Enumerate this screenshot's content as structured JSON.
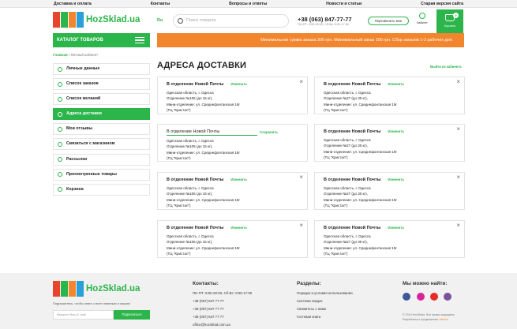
{
  "topbar": {
    "links": [
      "Доставка и оплата",
      "Контакты",
      "Вопросы и ответы",
      "Новости и статьи",
      "Старая версия сайта"
    ]
  },
  "header": {
    "logo_text": "HozSklad.ua",
    "lang": "Ru",
    "search_placeholder": "Поиск товаров",
    "phone": "+38 (063) 847-77-77",
    "hours": "ПН-ПТ: 9:00-20:00, Сб-Вс: 9:00-17:00",
    "callback": "Перезвонить мне",
    "cabinet": "Кабинет",
    "cart": "Корзина",
    "cart_count": "0"
  },
  "catalog_label": "КАТАЛОГ ТОВАРОВ",
  "promo": "Минимальная сумма заказа 300 грн. Минимальный заказ 100 грн. Сбор заказов 1-2 рабочих дня.",
  "breadcrumb": {
    "home": "Главная",
    "sep": " / ",
    "current": "Личный кабинет"
  },
  "menu": [
    {
      "label": "Личные данные",
      "active": false
    },
    {
      "label": "Список заказов",
      "active": false
    },
    {
      "label": "Список желаний",
      "active": false
    },
    {
      "label": "Адреса доставки",
      "active": true
    },
    {
      "label": "Мои отзывы",
      "active": false
    },
    {
      "label": "Связаться с магазином",
      "active": false
    },
    {
      "label": "Рассылки",
      "active": false
    },
    {
      "label": "Просмотренные товары",
      "active": false
    },
    {
      "label": "Корзина",
      "active": false
    }
  ],
  "page_title": "АДРЕСА ДОСТАВКИ",
  "logout": "Выйти из кабинета",
  "edit_label": "Изменить",
  "save_label": "Сохранить",
  "close_glyph": "×",
  "addresses": [
    {
      "title": "В отделение Новой Почты",
      "region": "Одесская область, г. Одесса",
      "branch": "Отделение №105 (до 15 кг),",
      "mini": "Мини-отделение: ул. Среднефонтанская 19г",
      "note": "(ТЦ \"Кристал\")",
      "editing": false
    },
    {
      "title": "В отделение Новой Почты",
      "region": "Одесская область, г. Одесса",
      "branch": "Отделение №27 (до 30 кг),",
      "mini": "Мини-отделение: ул. Среднефонтанская 19г",
      "note": "(ТЦ \"Кристал\")",
      "editing": false
    },
    {
      "title": "В отделение Новой Почты",
      "region": "Одесская область, г. Одесса",
      "branch": "Отделение №105 (до 15 кг),",
      "mini": "Мини-отделение: ул. Среднефонтанская 19г",
      "note": "(ТЦ \"Кристал\")",
      "editing": true
    },
    {
      "title": "В отделение Новой Почты",
      "region": "Одесская область, г. Одесса",
      "branch": "Отделение №27 (до 30 кг),",
      "mini": "Мини-отделение: ул. Среднефонтанская 19г",
      "note": "(ТЦ \"Кристал\")",
      "editing": false
    },
    {
      "title": "В отделение Новой Почты",
      "region": "Одесская область, г. Одесса",
      "branch": "Отделение №105 (до 15 кг),",
      "mini": "Мини-отделение: ул. Среднефонтанская 19г",
      "note": "(ТЦ \"Кристал\")",
      "editing": false
    },
    {
      "title": "В отделение Новой Почты",
      "region": "Одесская область, г. Одесса",
      "branch": "Отделение №27 (до 30 кг),",
      "mini": "Мини-отделение: ул. Среднефонтанская 19г",
      "note": "(ТЦ \"Кристал\")",
      "editing": false
    },
    {
      "title": "В отделение Новой Почты",
      "region": "Одесская область, г. Одесса",
      "branch": "Отделение №105 (до 15 кг),",
      "mini": "Мини-отделение: ул. Среднефонтанская 19г",
      "note": "(ТЦ \"Кристал\")",
      "editing": false
    },
    {
      "title": "В отделение Новой Почты",
      "region": "Одесская область, г. Одесса",
      "branch": "Отделение №27 (до 30 кг),",
      "mini": "Мини-отделение: ул. Среднефонтанская 19г",
      "note": "(ТЦ \"Кристал\")",
      "editing": false
    }
  ],
  "footer": {
    "logo_text": "HozSklad.ua",
    "subscribe_text": "Подпишитесь, чтобы знать о всех новинках и акциях",
    "email_placeholder": "Введите Ваш E-mail",
    "subscribe_btn": "Подписаться",
    "contacts_title": "Контакты:",
    "contacts": [
      "ПН-ПТ: 9:00-20:00, Сб-Вс: 9:00-17:00",
      "+38 (067) 847 77 77",
      "+38 (067) 847 77 77",
      "+38 (067) 847 77 77",
      "office@hozsklad.com.ua"
    ],
    "sections_title": "Разделы:",
    "sections": [
      "Порядок и условия использования",
      "Система скидок",
      "Свяжитесь с нами",
      "Гостевая книга"
    ],
    "social_title": "Мы можно найти:",
    "social": [
      {
        "name": "facebook-icon",
        "color": "#3b5998"
      },
      {
        "name": "instagram-icon",
        "color": "#d6249f"
      },
      {
        "name": "youtube-icon",
        "color": "#e52d27"
      },
      {
        "name": "viber-icon",
        "color": "#7b519d"
      }
    ],
    "copyright": "© 2019 HozSklad. Все права защищены",
    "dev_prefix": "Разработка и продвижение",
    "dev_name": "Maxiza"
  }
}
